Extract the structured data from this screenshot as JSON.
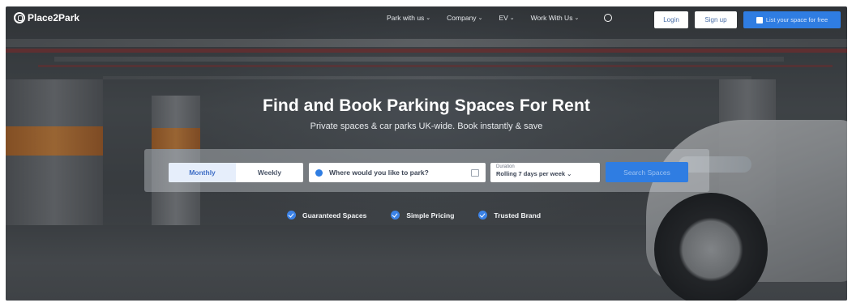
{
  "brand": {
    "name": "Place2Park"
  },
  "nav": {
    "menu": [
      {
        "label": "Park with us"
      },
      {
        "label": "Company"
      },
      {
        "label": "EV"
      },
      {
        "label": "Work With Us"
      }
    ],
    "login_label": "Login",
    "signup_label": "Sign up",
    "list_space_label": "List your space for free"
  },
  "hero": {
    "title": "Find and Book Parking Spaces For Rent",
    "subtitle": "Private spaces & car parks UK-wide. Book instantly & save"
  },
  "search": {
    "modes": [
      {
        "label": "Monthly",
        "active": true
      },
      {
        "label": "Weekly",
        "active": false
      }
    ],
    "location_placeholder": "Where would you like to park?",
    "duration_label": "Duration",
    "duration_value": "Rolling 7 days per week",
    "submit_label": "Search Spaces"
  },
  "features": [
    {
      "label": "Guaranteed Spaces"
    },
    {
      "label": "Simple Pricing"
    },
    {
      "label": "Trusted Brand"
    }
  ],
  "colors": {
    "accent": "#2f7de2",
    "white": "#ffffff"
  }
}
